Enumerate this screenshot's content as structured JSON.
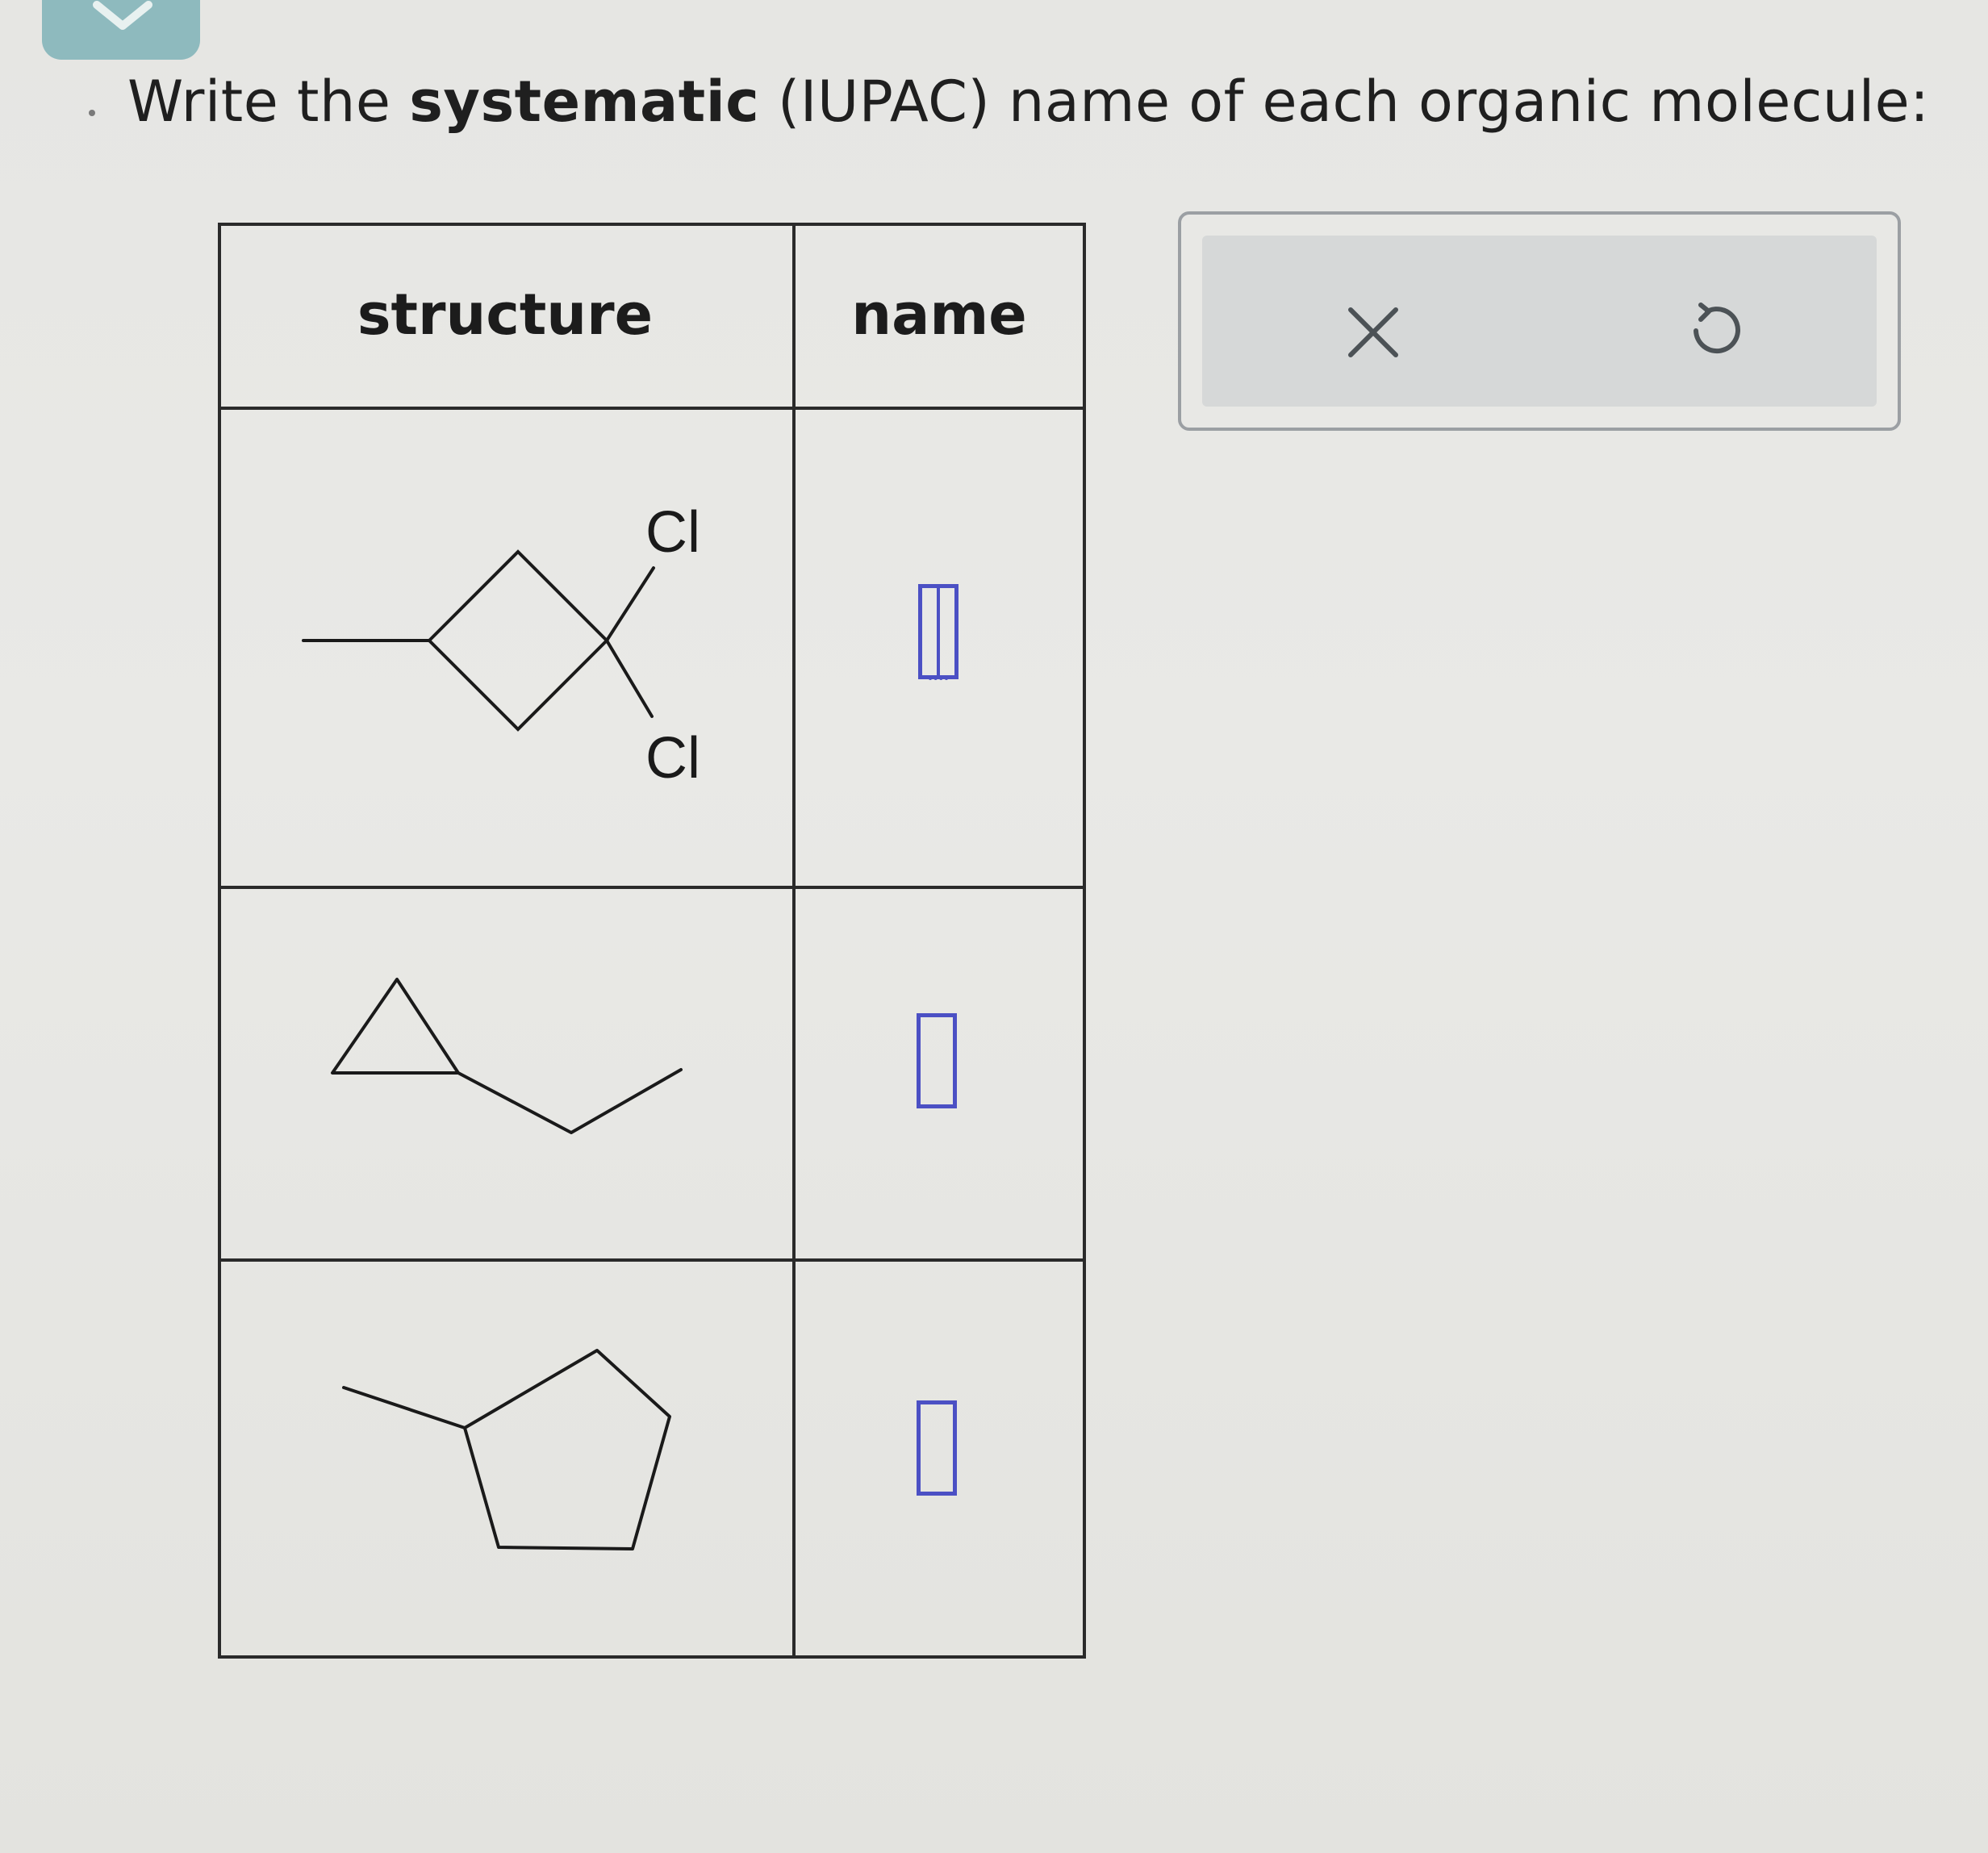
{
  "question": {
    "prefix": "Write the ",
    "bold": "systematic",
    "suffix": " (IUPAC) name of each organic molecule:"
  },
  "table": {
    "headers": {
      "structure": "structure",
      "name": "name"
    },
    "rows": [
      {
        "structure": "dichloro-methylcyclobutane",
        "atom_labels": [
          "Cl",
          "Cl"
        ],
        "answer": ""
      },
      {
        "structure": "ethylcyclopropane",
        "atom_labels": [],
        "answer": ""
      },
      {
        "structure": "methylcyclopentane",
        "atom_labels": [],
        "answer": ""
      }
    ]
  },
  "toolbar": {
    "clear_icon": "close-icon",
    "undo_icon": "undo-icon"
  },
  "colors": {
    "answer_box": "#4b50c4",
    "toolbar_bg": "#d6d8d8",
    "badge": "#7fb3b8"
  }
}
